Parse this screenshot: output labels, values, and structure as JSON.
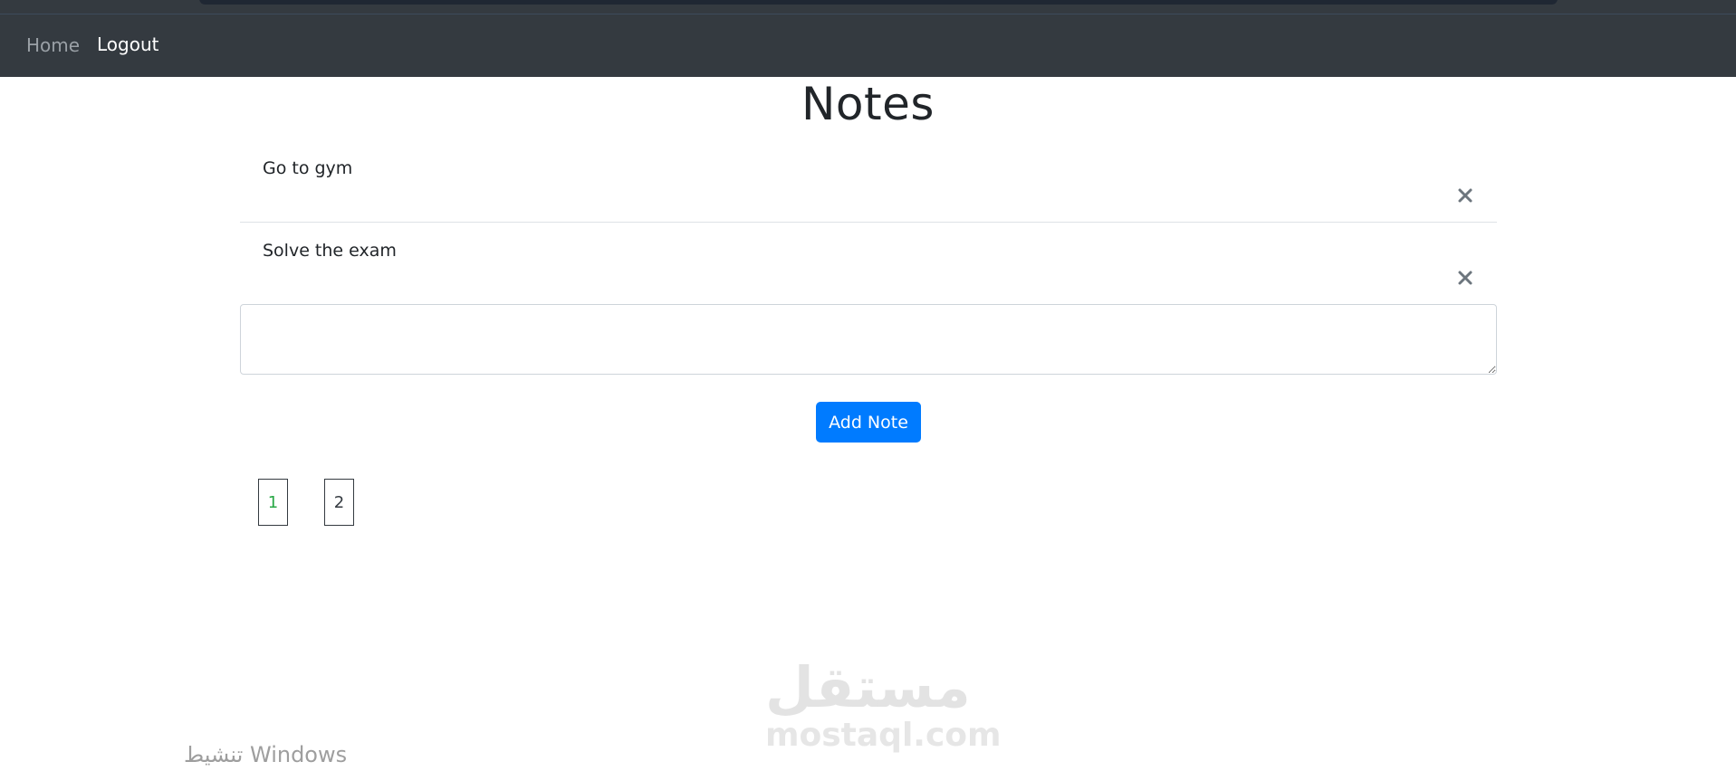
{
  "nav": {
    "home_label": "Home",
    "logout_label": "Logout"
  },
  "page": {
    "title": "Notes"
  },
  "notes": [
    {
      "text": "Go to gym"
    },
    {
      "text": "Solve the exam"
    }
  ],
  "input": {
    "value": "",
    "placeholder": ""
  },
  "actions": {
    "add_label": "Add Note"
  },
  "pagination": {
    "pages": [
      "1",
      "2"
    ],
    "active": "1"
  },
  "overlay": {
    "watermark_arabic": "مستقل",
    "watermark_latin": "mostaql.com",
    "os_activation": "تنشيط Windows"
  },
  "colors": {
    "navbar_bg": "#343a40",
    "primary": "#007bff",
    "active_page": "#28a745"
  },
  "icons": {
    "note_delete": "close-icon"
  }
}
